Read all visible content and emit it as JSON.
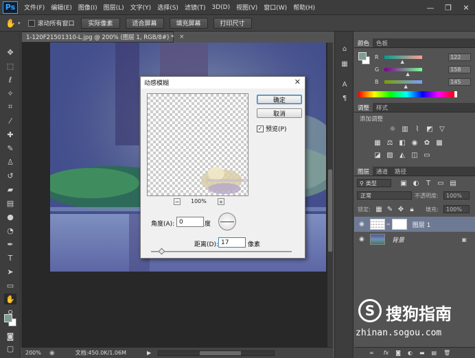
{
  "app": {
    "logo": "Ps"
  },
  "menu": [
    "文件(F)",
    "编辑(E)",
    "图像(I)",
    "图层(L)",
    "文字(Y)",
    "选择(S)",
    "滤镜(T)",
    "3D(D)",
    "视图(V)",
    "窗口(W)",
    "帮助(H)"
  ],
  "window_controls": {
    "minimize": "—",
    "restore": "❐",
    "close": "✕"
  },
  "options_bar": {
    "scroll_all_label": "滚动所有窗口",
    "buttons": [
      "实际像素",
      "适合屏幕",
      "填充屏幕",
      "打印尺寸"
    ]
  },
  "document": {
    "tab_title": "1-120F21501310-L.jpg @ 200% (图层 1, RGB/8#) *",
    "tab_close": "×",
    "zoom": "200%",
    "doc_info": "文档:450.0K/1.06M"
  },
  "dialog": {
    "title": "动感模糊",
    "close": "✕",
    "ok": "确定",
    "cancel": "取消",
    "preview_label": "预览(P)",
    "preview_checked": true,
    "zoom_minus": "−",
    "zoom_plus": "+",
    "zoom_level": "100%",
    "angle_label": "角度(A):",
    "angle_value": "0",
    "angle_unit": "度",
    "distance_label": "距离(D):",
    "distance_value": "17",
    "distance_unit": "像素",
    "distance_slider_fraction": 0.02
  },
  "color_panel": {
    "tabs": [
      "颜色",
      "色板"
    ],
    "channels": [
      {
        "label": "R",
        "value": "122",
        "position": 0.48
      },
      {
        "label": "G",
        "value": "158",
        "position": 0.62
      },
      {
        "label": "B",
        "value": "145",
        "position": 0.57
      }
    ]
  },
  "adjustments_panel": {
    "tabs": [
      "调整",
      "样式"
    ],
    "heading": "添加调整"
  },
  "layers_panel": {
    "tabs": [
      "图层",
      "通道",
      "路径"
    ],
    "filter_label": "类型",
    "blend_mode": "正常",
    "opacity_label": "不透明度:",
    "opacity_value": "100%",
    "lock_label": "锁定:",
    "fill_label": "填充:",
    "fill_value": "100%",
    "layers": [
      {
        "name": "图层 1",
        "selected": true
      },
      {
        "name": "背景",
        "selected": false
      }
    ],
    "footer_icons": [
      "fx"
    ]
  },
  "watermark": {
    "brand": "搜狗指南",
    "url": "zhinan.sogou.com",
    "logo_letter": "S"
  },
  "colors": {
    "foreground": "#7a9e91",
    "background": "#ffffff",
    "accent": "#31a8ff"
  }
}
